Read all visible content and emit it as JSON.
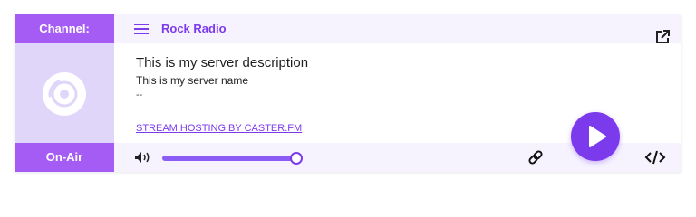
{
  "player": {
    "channel_label": "Channel:",
    "onair_label": "On-Air",
    "channel_name": "Rock Radio",
    "description_title": "This is my server description",
    "server_name": "This is my server name",
    "separator": "--",
    "hosting_link": "STREAM HOSTING BY CASTER.FM",
    "volume_level": 1.0
  },
  "colors": {
    "accent": "#a55cf5",
    "accent_dark": "#7c3aed",
    "panel_bg": "#e0d6f9",
    "bar_bg": "#f6f3ff"
  },
  "icons": {
    "menu": "menu-icon",
    "disc": "disc-icon",
    "popout": "external-link-icon",
    "volume": "volume-icon",
    "link": "link-icon",
    "play": "play-icon",
    "embed": "code-icon"
  }
}
